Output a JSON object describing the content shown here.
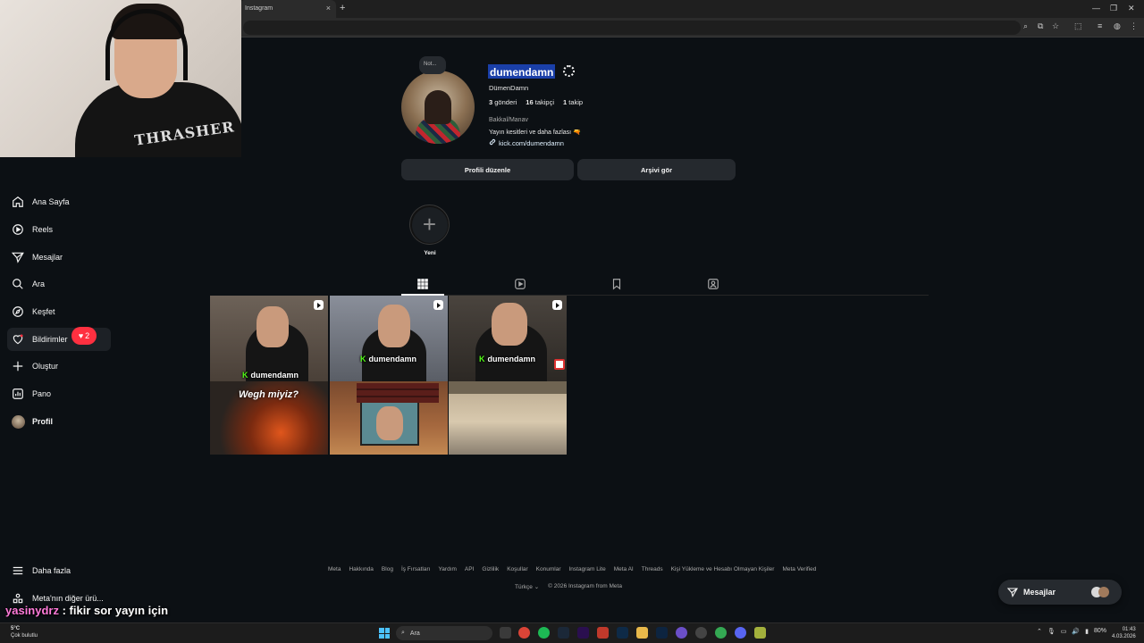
{
  "browser": {
    "tab_title": "Instagram",
    "tab_close": "×",
    "new_tab": "+"
  },
  "sidebar": {
    "items": [
      {
        "label": "Ana Sayfa",
        "icon": "home-icon"
      },
      {
        "label": "Reels",
        "icon": "reels-icon"
      },
      {
        "label": "Mesajlar",
        "icon": "messages-icon"
      },
      {
        "label": "Ara",
        "icon": "search-icon"
      },
      {
        "label": "Keşfet",
        "icon": "explore-icon"
      },
      {
        "label": "Bildirimler",
        "icon": "heart-icon"
      },
      {
        "label": "Oluştur",
        "icon": "plus-icon"
      },
      {
        "label": "Pano",
        "icon": "dashboard-icon"
      },
      {
        "label": "Profil",
        "icon": "profile-avatar"
      }
    ],
    "notifications_count": "2",
    "more_label": "Daha fazla",
    "meta_label": "Meta'nın diğer ürü..."
  },
  "profile": {
    "note": "Not...",
    "username": "dumendamn",
    "full_name": "DümenDamn",
    "posts_count": "3",
    "posts_label": "gönderi",
    "followers_count": "16",
    "followers_label": "takipçi",
    "following_count": "1",
    "following_label": "takip",
    "category": "Bakkal/Manav",
    "bio": "Yayın kesitleri ve daha fazlası 🔫",
    "link": "kick.com/dumendamn",
    "edit_button": "Profili düzenle",
    "archive_button": "Arşivi gör",
    "highlight_new": "Yeni"
  },
  "posts": [
    {
      "overlay": "dumendamn",
      "caption": "Wegh miyiz?"
    },
    {
      "overlay": "dumendamn",
      "caption": ""
    },
    {
      "overlay": "dumendamn",
      "caption": ""
    }
  ],
  "footer": {
    "links": [
      "Meta",
      "Hakkında",
      "Blog",
      "İş Fırsatları",
      "Yardım",
      "API",
      "Gizlilik",
      "Koşullar",
      "Konumlar",
      "Instagram Lite",
      "Meta AI",
      "Threads",
      "Kişi Yükleme ve Hesabı Olmayan Kişiler",
      "Meta Verified"
    ],
    "language": "Türkçe",
    "copyright": "© 2026 Instagram from Meta"
  },
  "messages_float": {
    "label": "Mesajlar"
  },
  "chat_overlay": {
    "user": "yasinydrz",
    "text": " : fikir sor yayın için"
  },
  "taskbar": {
    "weather_temp": "5°C",
    "weather_desc": "Çok bulutlu",
    "search_placeholder": "Ara",
    "battery": "80%",
    "time": "01:43",
    "date": "4.03.2026"
  },
  "colors": {
    "background": "#0c1014",
    "button": "#25292e",
    "notification": "#ff3040",
    "selection": "#1a3fa8",
    "kick_green": "#53fc18"
  }
}
